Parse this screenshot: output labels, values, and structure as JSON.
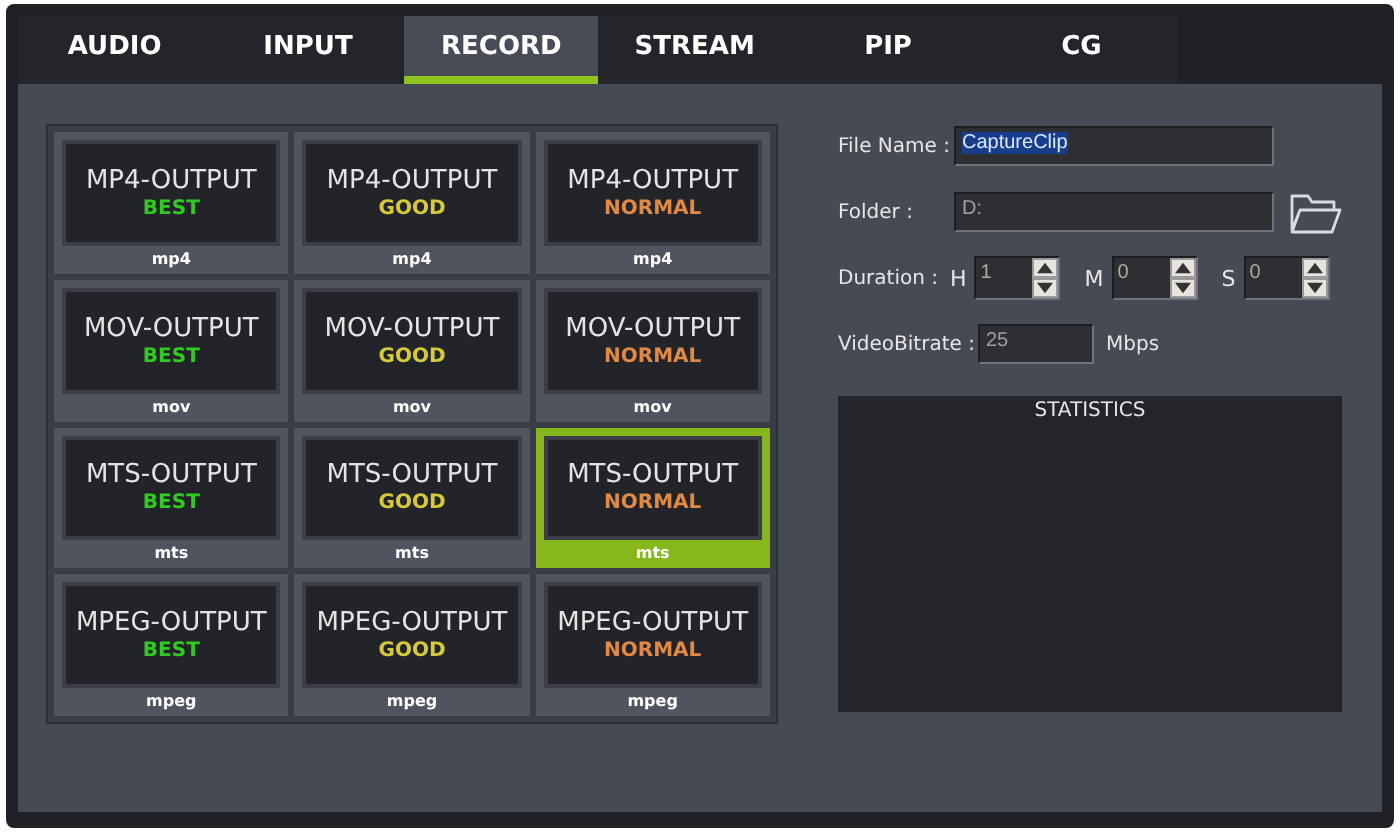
{
  "tabs": [
    {
      "label": "AUDIO",
      "selected": false
    },
    {
      "label": "INPUT",
      "selected": false
    },
    {
      "label": "RECORD",
      "selected": true
    },
    {
      "label": "STREAM",
      "selected": false
    },
    {
      "label": "PIP",
      "selected": false
    },
    {
      "label": "CG",
      "selected": false
    }
  ],
  "presets": [
    {
      "title": "MP4-OUTPUT",
      "quality": "BEST",
      "color": "#2ecc1f",
      "format": "mp4",
      "selected": false
    },
    {
      "title": "MP4-OUTPUT",
      "quality": "GOOD",
      "color": "#d6c93a",
      "format": "mp4",
      "selected": false
    },
    {
      "title": "MP4-OUTPUT",
      "quality": "NORMAL",
      "color": "#e08a45",
      "format": "mp4",
      "selected": false
    },
    {
      "title": "MOV-OUTPUT",
      "quality": "BEST",
      "color": "#2ecc1f",
      "format": "mov",
      "selected": false
    },
    {
      "title": "MOV-OUTPUT",
      "quality": "GOOD",
      "color": "#d6c93a",
      "format": "mov",
      "selected": false
    },
    {
      "title": "MOV-OUTPUT",
      "quality": "NORMAL",
      "color": "#e08a45",
      "format": "mov",
      "selected": false
    },
    {
      "title": "MTS-OUTPUT",
      "quality": "BEST",
      "color": "#2ecc1f",
      "format": "mts",
      "selected": false
    },
    {
      "title": "MTS-OUTPUT",
      "quality": "GOOD",
      "color": "#d6c93a",
      "format": "mts",
      "selected": false
    },
    {
      "title": "MTS-OUTPUT",
      "quality": "NORMAL",
      "color": "#e08a45",
      "format": "mts",
      "selected": true
    },
    {
      "title": "MPEG-OUTPUT",
      "quality": "BEST",
      "color": "#2ecc1f",
      "format": "mpeg",
      "selected": false
    },
    {
      "title": "MPEG-OUTPUT",
      "quality": "GOOD",
      "color": "#d6c93a",
      "format": "mpeg",
      "selected": false
    },
    {
      "title": "MPEG-OUTPUT",
      "quality": "NORMAL",
      "color": "#e08a45",
      "format": "mpeg",
      "selected": false
    }
  ],
  "file_name": {
    "label": "File Name :",
    "value": "CaptureClip",
    "highlighted": true
  },
  "folder": {
    "label": "Folder :",
    "value": "D:"
  },
  "duration": {
    "label": "Duration :",
    "fields": [
      {
        "unit": "H",
        "value": "1"
      },
      {
        "unit": "M",
        "value": "0"
      },
      {
        "unit": "S",
        "value": "0"
      }
    ]
  },
  "video_bitrate": {
    "label": "VideoBitrate :",
    "value": "25",
    "unit": "Mbps"
  },
  "statistics": {
    "title": "STATISTICS"
  }
}
